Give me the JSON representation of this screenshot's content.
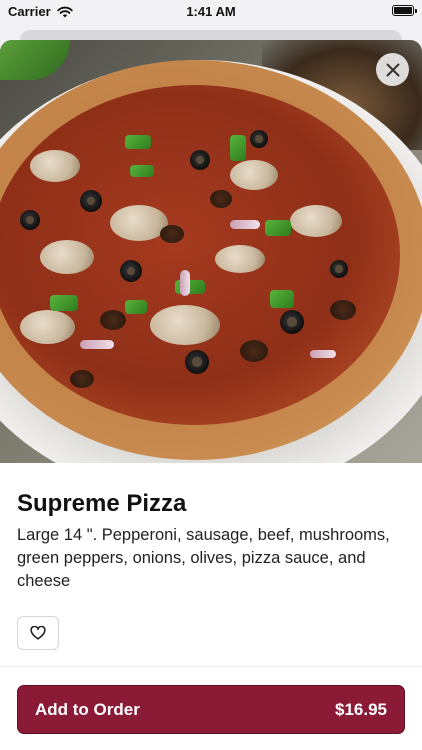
{
  "status_bar": {
    "carrier": "Carrier",
    "time": "1:41 AM"
  },
  "item": {
    "name": "Supreme Pizza",
    "description": "Large 14 \". Pepperoni, sausage, beef, mushrooms, green peppers, onions, olives, pizza sauce, and cheese"
  },
  "actions": {
    "add_label": "Add to Order",
    "price": "$16.95"
  },
  "icons": {
    "close": "close-icon",
    "favorite": "heart-icon",
    "wifi": "wifi-icon",
    "battery": "battery-icon"
  },
  "colors": {
    "accent": "#8a1a35",
    "background": "#f2f2f4",
    "sheet": "#ffffff"
  }
}
